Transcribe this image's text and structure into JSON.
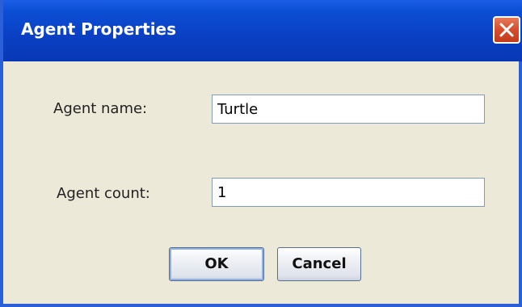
{
  "window": {
    "title": "Agent Properties",
    "close_icon": "close-icon"
  },
  "form": {
    "name_label": "Agent name:",
    "name_value": "Turtle",
    "count_label": "Agent count:",
    "count_value": "1"
  },
  "buttons": {
    "ok_label": "OK",
    "cancel_label": "Cancel"
  },
  "colors": {
    "titlebar": "#0a3fc4",
    "window_bg": "#ece9d8",
    "close_button": "#d6502f"
  }
}
